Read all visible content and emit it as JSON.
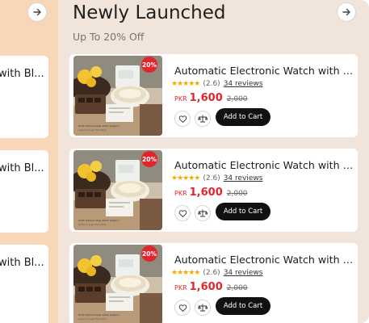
{
  "left": {
    "cards": [
      {
        "title": "with Bl..."
      },
      {
        "title": "with Bl..."
      },
      {
        "title": "with Bl..."
      }
    ]
  },
  "section": {
    "title": "Newly Launched",
    "subtitle": "Up To 20% Off"
  },
  "products": [
    {
      "title": "Automatic Electronic Watch with Bl...",
      "discount": "20%",
      "stars": "★★★★★",
      "rating": "(2.6)",
      "reviews": "34 reviews",
      "currency": "PKR",
      "price": "1,600",
      "old_price": "2,000",
      "cart_label": "Add to Cart"
    },
    {
      "title": "Automatic Electronic Watch with Bl...",
      "discount": "20%",
      "stars": "★★★★★",
      "rating": "(2.6)",
      "reviews": "34 reviews",
      "currency": "PKR",
      "price": "1,600",
      "old_price": "2,000",
      "cart_label": "Add to Cart"
    },
    {
      "title": "Automatic Electronic Watch with Bl...",
      "discount": "20%",
      "stars": "★★★★★",
      "rating": "(2.6)",
      "reviews": "34 reviews",
      "currency": "PKR",
      "price": "1,600",
      "old_price": "2,000",
      "cart_label": "Add to Cart"
    }
  ],
  "colors": {
    "left_bg": "#f8d7b8",
    "right_bg": "#f1e4da",
    "price_red": "#e0262c",
    "star": "#f6a800",
    "button": "#111111"
  },
  "icons": [
    "arrow-right-icon",
    "heart-icon",
    "compare-scale-icon"
  ]
}
